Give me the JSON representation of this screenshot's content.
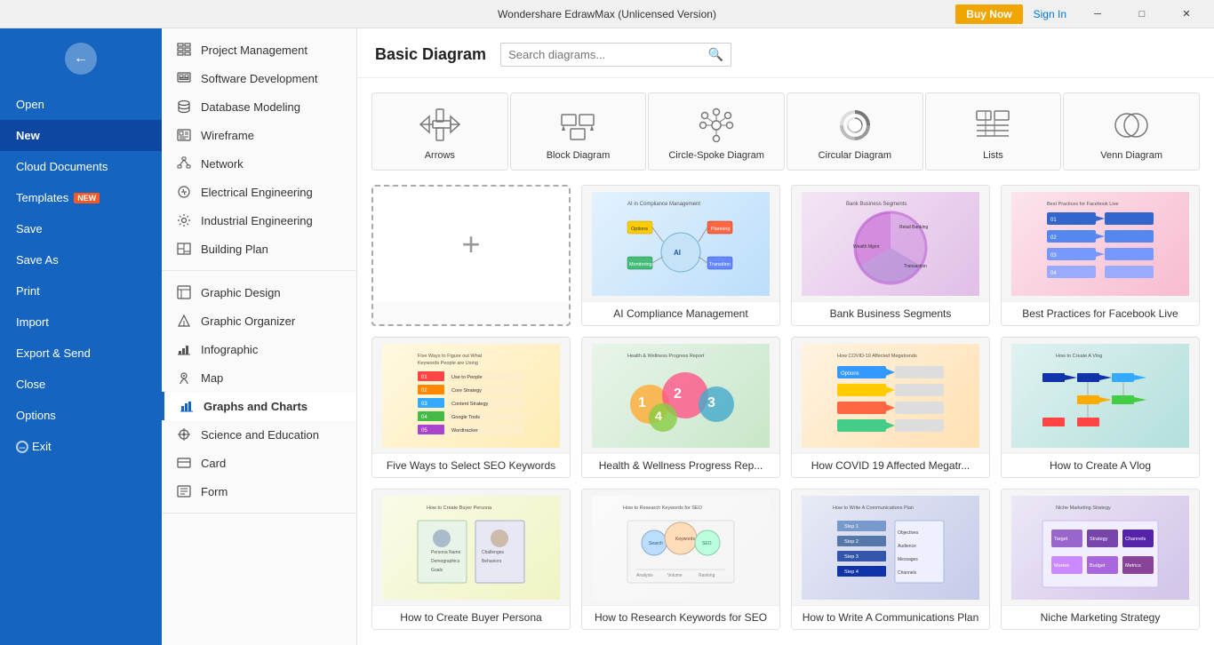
{
  "titleBar": {
    "title": "Wondershare EdrawMax (Unlicensed Version)",
    "minimizeLabel": "─",
    "maximizeLabel": "□",
    "closeLabel": "✕",
    "buyNowLabel": "Buy Now",
    "signInLabel": "Sign In"
  },
  "leftSidebar": {
    "items": [
      {
        "id": "open",
        "label": "Open",
        "active": false
      },
      {
        "id": "new",
        "label": "New",
        "active": true
      },
      {
        "id": "cloud-documents",
        "label": "Cloud Documents",
        "active": false
      },
      {
        "id": "templates",
        "label": "Templates",
        "active": false,
        "badge": "NEW"
      },
      {
        "id": "save",
        "label": "Save",
        "active": false
      },
      {
        "id": "save-as",
        "label": "Save As",
        "active": false
      },
      {
        "id": "print",
        "label": "Print",
        "active": false
      },
      {
        "id": "import",
        "label": "Import",
        "active": false
      },
      {
        "id": "export-send",
        "label": "Export & Send",
        "active": false
      },
      {
        "id": "close",
        "label": "Close",
        "active": false
      },
      {
        "id": "options",
        "label": "Options",
        "active": false
      },
      {
        "id": "exit",
        "label": "Exit",
        "active": false,
        "hasIcon": true
      }
    ]
  },
  "categoryPanel": {
    "sections": [
      {
        "items": [
          {
            "id": "project-management",
            "label": "Project Management",
            "icon": "grid"
          },
          {
            "id": "software-development",
            "label": "Software Development",
            "icon": "code"
          },
          {
            "id": "database-modeling",
            "label": "Database Modeling",
            "icon": "database"
          },
          {
            "id": "wireframe",
            "label": "Wireframe",
            "icon": "wireframe"
          },
          {
            "id": "network",
            "label": "Network",
            "icon": "network"
          },
          {
            "id": "electrical-engineering",
            "label": "Electrical Engineering",
            "icon": "electrical"
          },
          {
            "id": "industrial-engineering",
            "label": "Industrial Engineering",
            "icon": "industrial"
          },
          {
            "id": "building-plan",
            "label": "Building Plan",
            "icon": "building"
          }
        ]
      },
      {
        "items": [
          {
            "id": "graphic-design",
            "label": "Graphic Design",
            "icon": "graphic"
          },
          {
            "id": "graphic-organizer",
            "label": "Graphic Organizer",
            "icon": "organizer"
          },
          {
            "id": "infographic",
            "label": "Infographic",
            "icon": "infographic"
          },
          {
            "id": "map",
            "label": "Map",
            "icon": "map"
          },
          {
            "id": "graphs-charts",
            "label": "Graphs and Charts",
            "icon": "chart",
            "active": true
          },
          {
            "id": "science-education",
            "label": "Science and Education",
            "icon": "science"
          },
          {
            "id": "card",
            "label": "Card",
            "icon": "card"
          },
          {
            "id": "form",
            "label": "Form",
            "icon": "form"
          }
        ]
      }
    ]
  },
  "contentArea": {
    "title": "Basic Diagram",
    "search": {
      "placeholder": "Search diagrams...",
      "value": ""
    },
    "diagramTypes": [
      {
        "id": "arrows",
        "label": "Arrows"
      },
      {
        "id": "block-diagram",
        "label": "Block Diagram"
      },
      {
        "id": "circle-spoke-diagram",
        "label": "Circle-Spoke Diagram"
      },
      {
        "id": "circular-diagram",
        "label": "Circular Diagram"
      },
      {
        "id": "lists",
        "label": "Lists"
      },
      {
        "id": "venn-diagram",
        "label": "Venn Diagram"
      }
    ],
    "templates": [
      {
        "id": "new",
        "label": "",
        "isNew": true
      },
      {
        "id": "ai-compliance-management",
        "label": "AI Compliance Management",
        "previewClass": "preview-compliance"
      },
      {
        "id": "bank-business-segments",
        "label": "Bank Business Segments",
        "previewClass": "preview-bank"
      },
      {
        "id": "best-practices-fb-live",
        "label": "Best Practices for Facebook Live",
        "previewClass": "preview-fb"
      },
      {
        "id": "five-ways-seo",
        "label": "Five Ways to Select SEO Keywords",
        "previewClass": "preview-seo"
      },
      {
        "id": "health-wellness-progress",
        "label": "Health & Wellness Progress Rep...",
        "previewClass": "preview-health"
      },
      {
        "id": "how-covid-megatrends",
        "label": "How COVID 19 Affected Megatr...",
        "previewClass": "preview-covid"
      },
      {
        "id": "how-to-create-vlog",
        "label": "How to Create A Vlog",
        "previewClass": "preview-vlog"
      },
      {
        "id": "buyer-persona",
        "label": "How to Create Buyer Persona",
        "previewClass": "preview-buyer"
      },
      {
        "id": "keywords-research",
        "label": "How to Research Keywords for SEO",
        "previewClass": "preview-keywords"
      },
      {
        "id": "comms-plan",
        "label": "How to Write A Communications Plan",
        "previewClass": "preview-comms"
      },
      {
        "id": "niche-marketing",
        "label": "Niche Marketing Strategy",
        "previewClass": "preview-marketing"
      }
    ]
  }
}
